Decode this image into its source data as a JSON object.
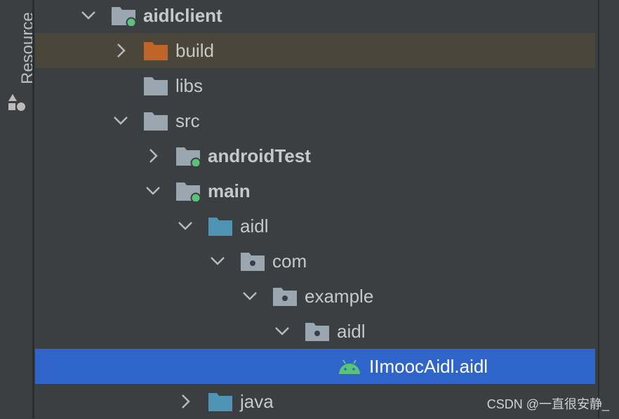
{
  "sidebar": {
    "resource_tab_label": "Resource",
    "resource_icon": "shapes-icon"
  },
  "tree": [
    {
      "label": "aidlclient",
      "bold": true,
      "expanded": true,
      "icon": "module-folder-icon",
      "highlight": "none"
    },
    {
      "label": "build",
      "bold": false,
      "expanded": false,
      "icon": "excluded-folder-icon",
      "highlight": "excluded"
    },
    {
      "label": "libs",
      "bold": false,
      "expanded": null,
      "icon": "folder-icon",
      "highlight": "none"
    },
    {
      "label": "src",
      "bold": false,
      "expanded": true,
      "icon": "folder-icon",
      "highlight": "none"
    },
    {
      "label": "androidTest",
      "bold": true,
      "expanded": false,
      "icon": "source-set-folder-icon",
      "highlight": "none"
    },
    {
      "label": "main",
      "bold": true,
      "expanded": true,
      "icon": "source-set-folder-icon",
      "highlight": "none"
    },
    {
      "label": "aidl",
      "bold": false,
      "expanded": true,
      "icon": "source-root-folder-icon",
      "highlight": "none"
    },
    {
      "label": "com",
      "bold": false,
      "expanded": true,
      "icon": "package-folder-icon",
      "highlight": "none"
    },
    {
      "label": "example",
      "bold": false,
      "expanded": true,
      "icon": "package-folder-icon",
      "highlight": "none"
    },
    {
      "label": "aidl",
      "bold": false,
      "expanded": true,
      "icon": "package-folder-icon",
      "highlight": "none"
    },
    {
      "label": "IImoocAidl.aidl",
      "bold": false,
      "expanded": null,
      "icon": "android-icon",
      "highlight": "selected"
    },
    {
      "label": "java",
      "bold": false,
      "expanded": false,
      "icon": "source-root-folder-icon",
      "highlight": "none"
    }
  ],
  "colors": {
    "selection": "#2f65ca",
    "excluded_row": "#4a463a",
    "excluded_folder": "#c0642a",
    "source_root_folder": "#4f93b5",
    "android_green": "#5ac379",
    "module_badge": "#5ac379"
  },
  "watermark": "CSDN @一直很安静_"
}
